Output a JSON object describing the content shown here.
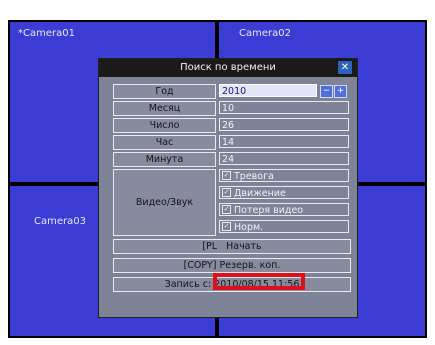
{
  "cameras": [
    {
      "label": "*Camera01"
    },
    {
      "label": "Camera02"
    },
    {
      "label": "Camera03"
    },
    {
      "label": ""
    }
  ],
  "dialog": {
    "title": "Поиск по времени",
    "close_icon": "✕",
    "fields": [
      {
        "label": "Год",
        "value": "2010"
      },
      {
        "label": "Месяц",
        "value": "10"
      },
      {
        "label": "Число",
        "value": "26"
      },
      {
        "label": "Час",
        "value": "14"
      },
      {
        "label": "Минута",
        "value": "24"
      }
    ],
    "spin_minus": "−",
    "spin_plus": "+",
    "video_audio_label": "Видео/Звук",
    "options": [
      {
        "label": "Тревога",
        "checked": true
      },
      {
        "label": "Движение",
        "checked": true
      },
      {
        "label": "Потеря видео",
        "checked": true
      },
      {
        "label": "Норм.",
        "checked": true
      }
    ],
    "play_button": "[PL",
    "play_button_tail": "Начать",
    "copy_button": "[COPY] Резерв. коп.",
    "record_from": "Запись с: 2010/08/15 11:56"
  },
  "colors": {
    "camera_bg": "#3a3cd4",
    "dialog_bg": "#7f8398",
    "highlight": "#e0101a"
  }
}
